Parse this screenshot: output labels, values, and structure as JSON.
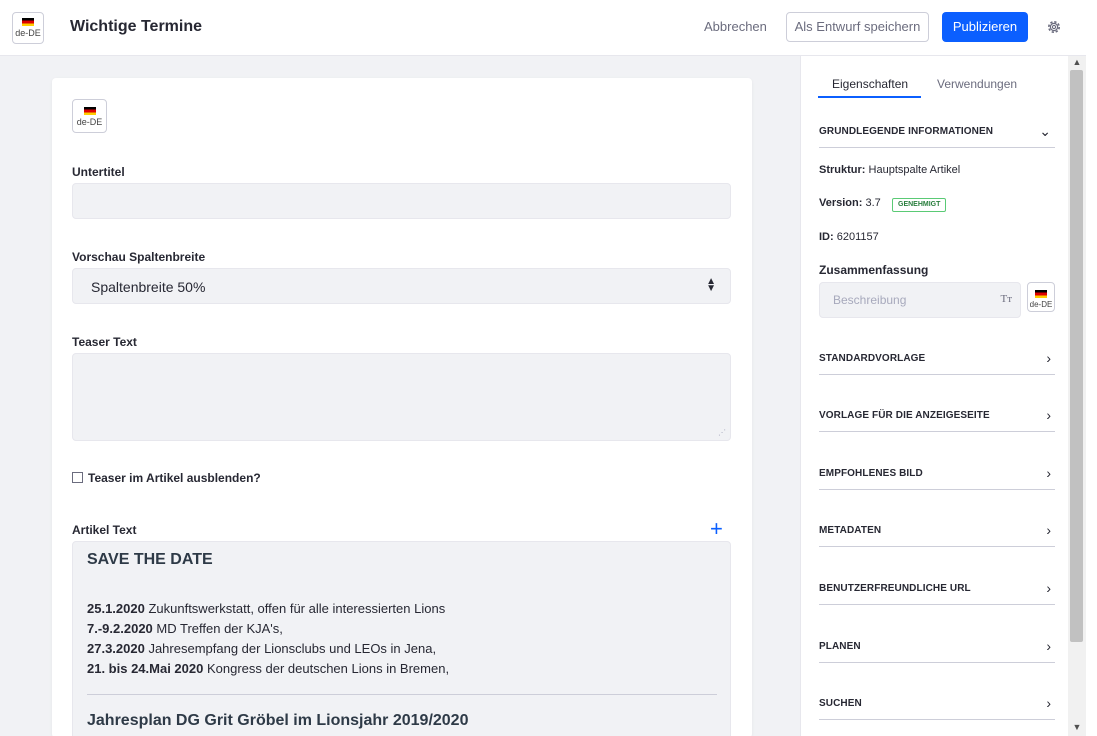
{
  "header": {
    "lang": "de-DE",
    "title": "Wichtige Termine",
    "cancel_label": "Abbrechen",
    "draft_label": "Als Entwurf speichern",
    "publish_label": "Publizieren"
  },
  "form": {
    "lang": "de-DE",
    "subtitle_label": "Untertitel",
    "subtitle_value": "",
    "preview_label": "Vorschau Spaltenbreite",
    "preview_value": "Spaltenbreite 50%",
    "teaser_label": "Teaser Text",
    "teaser_value": "",
    "hide_teaser_label": "Teaser im Artikel ausblenden?",
    "hide_teaser_checked": false,
    "article_label": "Artikel Text",
    "article": {
      "heading": "SAVE THE DATE",
      "lines": [
        {
          "bold": "25.1.2020",
          "text": " Zukunftswerkstatt, offen für alle interessierten Lions"
        },
        {
          "bold": "7.-9.2.2020",
          "text": " MD Treffen der KJA's,"
        },
        {
          "bold": "27.3.2020",
          "text": " Jahresempfang der Lionsclubs und LEOs in Jena,"
        },
        {
          "bold": "21. bis 24.Mai 2020",
          "text": " Kongress der deutschen Lions in Bremen,"
        }
      ],
      "subheading": "Jahresplan DG Grit Gröbel im Lionsjahr 2019/2020"
    }
  },
  "sidebar": {
    "tabs": [
      "Eigenschaften",
      "Verwendungen"
    ],
    "basic_info_title": "GRUNDLEGENDE INFORMATIONEN",
    "structure_label": "Struktur:",
    "structure_value": "Hauptspalte Artikel",
    "version_label": "Version:",
    "version_value": "3.7",
    "status_badge": "GENEHMIGT",
    "id_label": "ID:",
    "id_value": "6201157",
    "summary_label": "Zusammenfassung",
    "summary_placeholder": "Beschreibung",
    "summary_lang": "de-DE",
    "sections": [
      "STANDARDVORLAGE",
      "VORLAGE FÜR DIE ANZEIGESEITE",
      "EMPFOHLENES BILD",
      "METADATEN",
      "BENUTZERFREUNDLICHE URL",
      "PLANEN",
      "SUCHEN"
    ]
  },
  "colors": {
    "primary": "#0b5fff",
    "success": "#287d3c"
  },
  "icons": [
    "flag-de-icon",
    "gear-icon",
    "plus-icon",
    "chevron-down-icon",
    "chevron-right-icon",
    "text-format-icon"
  ]
}
